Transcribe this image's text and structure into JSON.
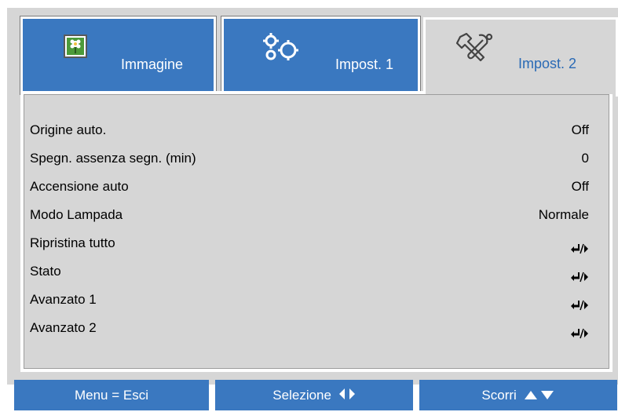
{
  "tabs": [
    {
      "label": "Immagine",
      "icon": "image-icon",
      "active": false
    },
    {
      "label": "Impost. 1",
      "icon": "gears-icon",
      "active": false
    },
    {
      "label": "Impost. 2",
      "icon": "tools-icon",
      "active": true
    }
  ],
  "menu": {
    "items": [
      {
        "label": "Origine auto.",
        "value": "Off"
      },
      {
        "label": "Spegn. assenza segn. (min)",
        "value": "0"
      },
      {
        "label": "Accensione auto",
        "value": "Off"
      },
      {
        "label": "Modo Lampada",
        "value": "Normale"
      },
      {
        "label": "Ripristina tutto",
        "value": "",
        "icon": "enter-right-arrow-icon"
      },
      {
        "label": "Stato",
        "value": "",
        "icon": "enter-right-arrow-icon"
      },
      {
        "label": "Avanzato 1",
        "value": "",
        "icon": "enter-right-arrow-icon"
      },
      {
        "label": "Avanzato 2",
        "value": "",
        "icon": "enter-right-arrow-icon"
      }
    ]
  },
  "footer": {
    "menu_label": "Menu = Esci",
    "select_label": "Selezione",
    "scroll_label": "Scorri"
  },
  "colors": {
    "tab_blue": "#3a78c0",
    "panel_gray": "#d6d6d6",
    "active_tab_text": "#2a6ab5"
  }
}
